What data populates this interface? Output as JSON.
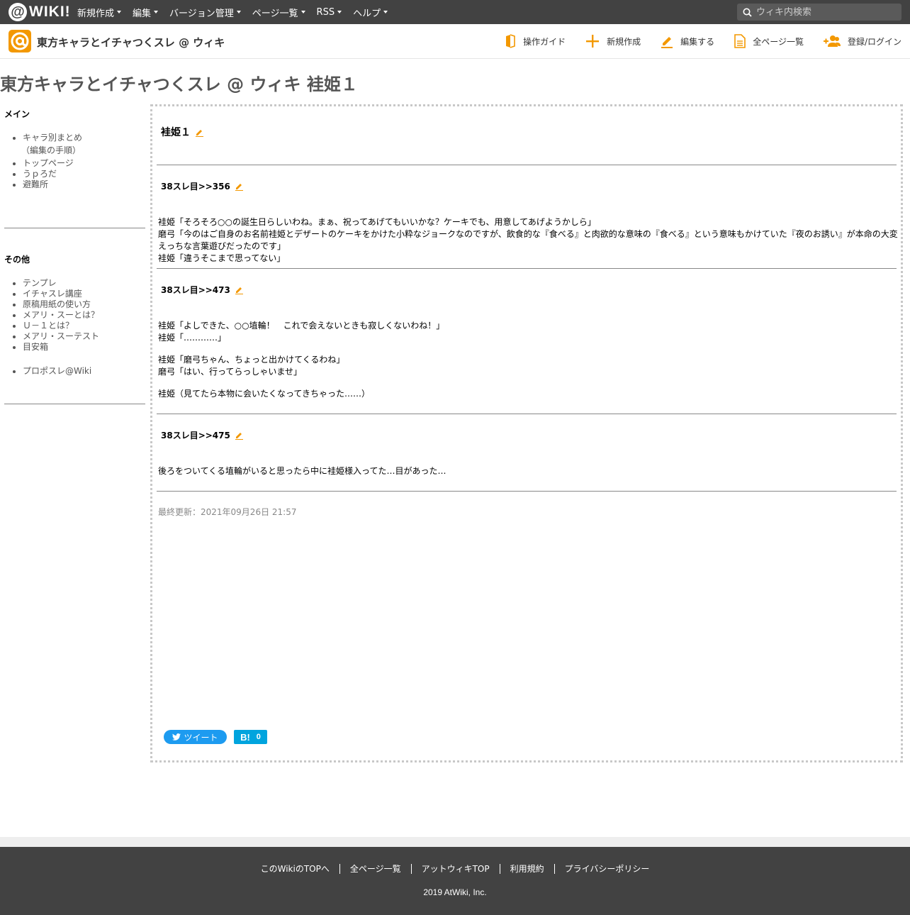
{
  "topbar": {
    "logo_text": "WIKI!",
    "nav": [
      "新規作成",
      "編集",
      "バージョン管理",
      "ページ一覧",
      "RSS",
      "ヘルプ"
    ],
    "search_placeholder": "ウィキ内検索"
  },
  "header": {
    "site_title": "東方キャラとイチャつくスレ @ ウィキ",
    "actions": [
      "操作ガイド",
      "新規作成",
      "編集する",
      "全ページ一覧",
      "登録/ログイン"
    ]
  },
  "page": {
    "title": "東方キャラとイチャつくスレ @ ウィキ 袿姫１"
  },
  "sidebar": {
    "main_heading": "メイン",
    "main_items": [
      "キャラ別まとめ",
      "（編集の手順）",
      "トップページ",
      "うｐろだ",
      "避難所"
    ],
    "other_heading": "その他",
    "other_items": [
      "テンプレ",
      "イチャスレ講座",
      "原稿用紙の使い方",
      "メアリ・スーとは？",
      "Ｕ－１とは？",
      "メアリ・スーテスト",
      "目安箱"
    ],
    "extra_items": [
      "プロポスレ@Wiki"
    ]
  },
  "content": {
    "heading": "袿姫１",
    "sections": [
      {
        "title": "38スレ目>>356",
        "lines": [
          "袿姫「そろそろ○○の誕生日らしいわね。まぁ、祝ってあげてもいいかな？ケーキでも、用意してあげようかしら」",
          "磨弓「今のはご自身のお名前袿姫とデザートのケーキをかけた小粋なジョークなのですが、飲食的な『食べる』と肉欲的な意味の『食べる』という意味もかけていた『夜のお誘い』が本命の大変",
          "えっちな言葉遊びだったのです」",
          "袿姫「違うそこまで思ってない」"
        ]
      },
      {
        "title": "38スレ目>>473",
        "lines": [
          "袿姫「よしできた、○○埴輪！　これで会えないときも寂しくないわね！」",
          "袿姫「…………」",
          "袿姫「磨弓ちゃん、ちょっと出かけてくるわね」",
          "磨弓「はい、行ってらっしゃいませ」",
          "袿姫（見てたら本物に会いたくなってきちゃった……）"
        ]
      },
      {
        "title": "38スレ目>>475",
        "lines": [
          "後ろをついてくる埴輪がいると思ったら中に袿姫様入ってた…目があった…"
        ]
      }
    ],
    "last_updated": "最終更新：2021年09月26日 21:57",
    "tweet_label": "ツイート",
    "hatena_label": "B!",
    "hatena_count": "0"
  },
  "footer": {
    "links": [
      "このWikiのTOPへ",
      "全ページ一覧",
      "アットウィキTOP",
      "利用規約",
      "プライバシーポリシー"
    ],
    "copyright": "2019 AtWiki, Inc."
  },
  "colors": {
    "topbar": "#424242",
    "accent": "#f39800",
    "tweet": "#1d9bf0",
    "hatena": "#00a4de"
  }
}
